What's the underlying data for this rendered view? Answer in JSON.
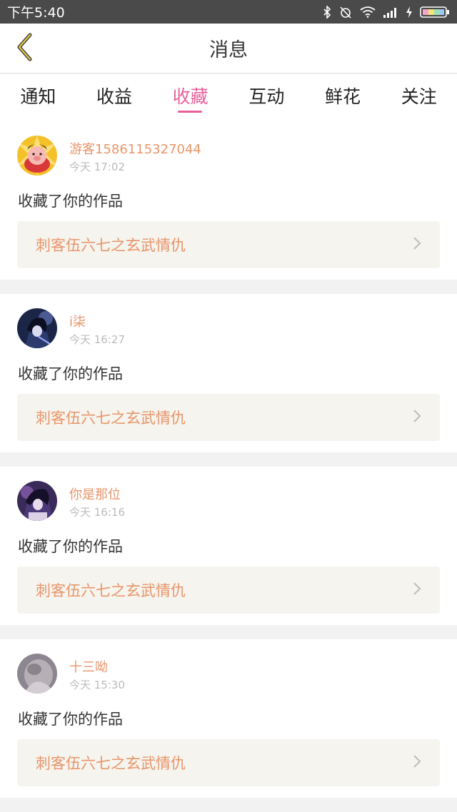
{
  "status": {
    "time": "下午5:40"
  },
  "nav": {
    "title": "消息"
  },
  "tabs": [
    {
      "label": "通知"
    },
    {
      "label": "收益"
    },
    {
      "label": "收藏"
    },
    {
      "label": "互动"
    },
    {
      "label": "鲜花"
    },
    {
      "label": "关注"
    }
  ],
  "active_tab": "收藏",
  "colors": {
    "accent": "#e8609a",
    "name": "#e8956a"
  },
  "items": [
    {
      "user": "游客1586115327044",
      "time": "今天 17:02",
      "action": "收藏了你的作品",
      "work": "刺客伍六七之玄武情仇"
    },
    {
      "user": "i柒",
      "time": "今天 16:27",
      "action": "收藏了你的作品",
      "work": "刺客伍六七之玄武情仇"
    },
    {
      "user": "你是那位",
      "time": "今天 16:16",
      "action": "收藏了你的作品",
      "work": "刺客伍六七之玄武情仇"
    },
    {
      "user": "十三呦",
      "time": "今天 15:30",
      "action": "收藏了你的作品",
      "work": "刺客伍六七之玄武情仇"
    }
  ]
}
